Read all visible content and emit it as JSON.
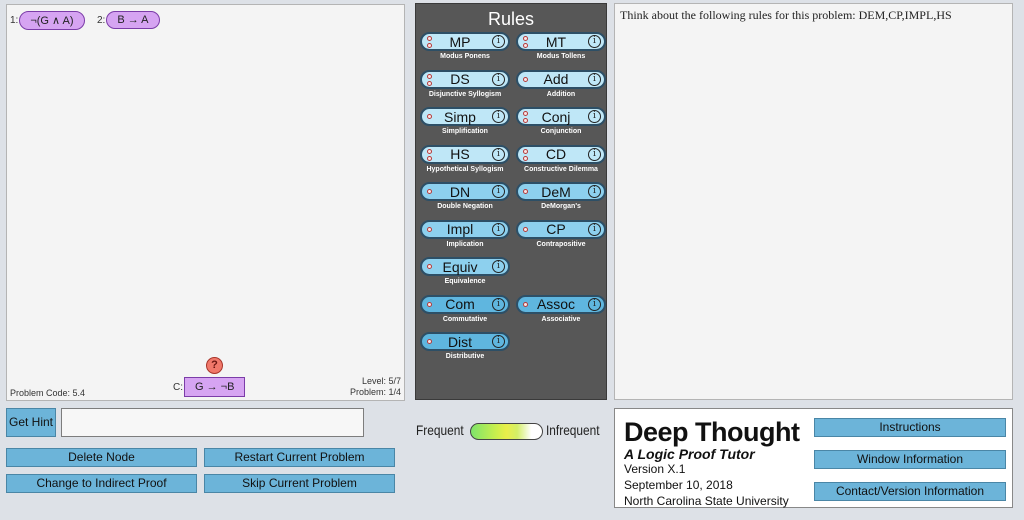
{
  "proof": {
    "premises": [
      {
        "num": "1:",
        "formula": "¬(G ∧ A)"
      },
      {
        "num": "2:",
        "formula": "B → A"
      }
    ],
    "conclusion_prefix": "C:",
    "conclusion": "G → ¬B",
    "hint_icon": "?",
    "problem_code": "Problem Code: 5.4",
    "level": "Level: 5/7",
    "problem": "Problem: 1/4"
  },
  "rules": {
    "title": "Rules",
    "items": [
      {
        "name": "MP",
        "desc": "Modus Ponens",
        "dots": 2,
        "shade": "light"
      },
      {
        "name": "MT",
        "desc": "Modus Tollens",
        "dots": 2,
        "shade": "light"
      },
      {
        "name": "DS",
        "desc": "Disjunctive Syllogism",
        "dots": 2,
        "shade": "light"
      },
      {
        "name": "Add",
        "desc": "Addition",
        "dots": 1,
        "shade": "light"
      },
      {
        "name": "Simp",
        "desc": "Simplification",
        "dots": 1,
        "shade": "light"
      },
      {
        "name": "Conj",
        "desc": "Conjunction",
        "dots": 2,
        "shade": "light"
      },
      {
        "name": "HS",
        "desc": "Hypothetical Syllogism",
        "dots": 2,
        "shade": "light"
      },
      {
        "name": "CD",
        "desc": "Constructive Dilemma",
        "dots": 3,
        "shade": "light"
      },
      {
        "name": "DN",
        "desc": "Double Negation",
        "dots": 1,
        "shade": "mid"
      },
      {
        "name": "DeM",
        "desc": "DeMorgan's",
        "dots": 1,
        "shade": "mid"
      },
      {
        "name": "Impl",
        "desc": "Implication",
        "dots": 1,
        "shade": "mid"
      },
      {
        "name": "CP",
        "desc": "Contrapositive",
        "dots": 1,
        "shade": "mid"
      },
      {
        "name": "Equiv",
        "desc": "Equivalence",
        "dots": 1,
        "shade": "mid"
      },
      {
        "name": "Com",
        "desc": "Commutative",
        "dots": 1,
        "shade": "dark"
      },
      {
        "name": "Assoc",
        "desc": "Associative",
        "dots": 1,
        "shade": "dark"
      },
      {
        "name": "Dist",
        "desc": "Distributive",
        "dots": 1,
        "shade": "dark"
      }
    ]
  },
  "message": "Think about the following rules for this problem: DEM,CP,IMPL,HS",
  "buttons": {
    "get_hint": "Get Hint",
    "delete_node": "Delete Node",
    "restart": "Restart Current Problem",
    "indirect": "Change to Indirect Proof",
    "skip": "Skip Current Problem",
    "instructions": "Instructions",
    "window_info": "Window Information",
    "contact": "Contact/Version Information"
  },
  "slider": {
    "left_label": "Frequent",
    "right_label": "Infrequent"
  },
  "about": {
    "title": "Deep Thought",
    "subtitle": "A Logic Proof Tutor",
    "version": "Version X.1",
    "date": "September 10, 2018",
    "org": "North Carolina State University"
  },
  "colors": {
    "node_fill": "#d6a4f2",
    "rule_light": "#bfe7f7",
    "rule_mid": "#8dd0ee",
    "rule_dark": "#5fb6df",
    "button": "#6cb4d9",
    "panel": "#575757"
  }
}
